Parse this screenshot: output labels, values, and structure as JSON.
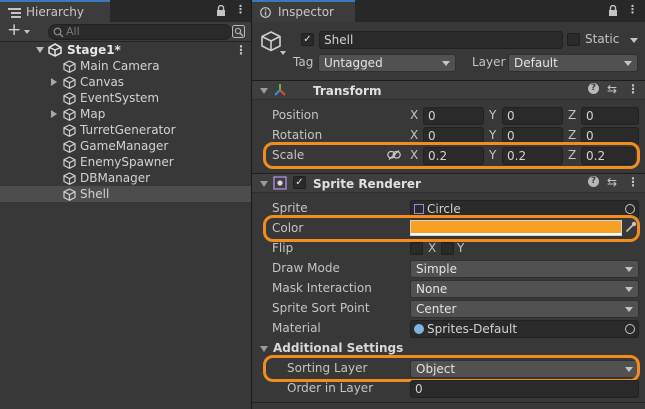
{
  "hierarchy": {
    "tab_label": "Hierarchy",
    "search_placeholder": "All",
    "scene_name": "Stage1*",
    "items": [
      {
        "label": "Main Camera",
        "expandable": false
      },
      {
        "label": "Canvas",
        "expandable": true
      },
      {
        "label": "EventSystem",
        "expandable": false
      },
      {
        "label": "Map",
        "expandable": true
      },
      {
        "label": "TurretGenerator",
        "expandable": false
      },
      {
        "label": "GameManager",
        "expandable": false
      },
      {
        "label": "EnemySpawner",
        "expandable": false
      },
      {
        "label": "DBManager",
        "expandable": false
      },
      {
        "label": "Shell",
        "expandable": false,
        "selected": true
      }
    ]
  },
  "inspector": {
    "tab_label": "Inspector",
    "object_name": "Shell",
    "static_label": "Static",
    "tag_label": "Tag",
    "tag_value": "Untagged",
    "layer_label": "Layer",
    "layer_value": "Default",
    "transform": {
      "title": "Transform",
      "position_label": "Position",
      "rotation_label": "Rotation",
      "scale_label": "Scale",
      "position": {
        "x": "0",
        "y": "0",
        "z": "0"
      },
      "rotation": {
        "x": "0",
        "y": "0",
        "z": "0"
      },
      "scale": {
        "x": "0.2",
        "y": "0.2",
        "z": "0.2"
      },
      "axis_x": "X",
      "axis_y": "Y",
      "axis_z": "Z"
    },
    "sprite_renderer": {
      "title": "Sprite Renderer",
      "sprite_label": "Sprite",
      "sprite_value": "Circle",
      "color_label": "Color",
      "color_value": "#f7a023",
      "flip_label": "Flip",
      "flip_x": "X",
      "flip_y": "Y",
      "draw_mode_label": "Draw Mode",
      "draw_mode_value": "Simple",
      "mask_label": "Mask Interaction",
      "mask_value": "None",
      "sort_point_label": "Sprite Sort Point",
      "sort_point_value": "Center",
      "material_label": "Material",
      "material_value": "Sprites-Default",
      "additional_label": "Additional Settings",
      "sorting_layer_label": "Sorting Layer",
      "sorting_layer_value": "Object",
      "order_label": "Order in Layer",
      "order_value": "0"
    }
  },
  "colors": {
    "highlight": "#f28c1e",
    "accent_tab": "#3a79bb",
    "panel_bg": "#383838"
  }
}
